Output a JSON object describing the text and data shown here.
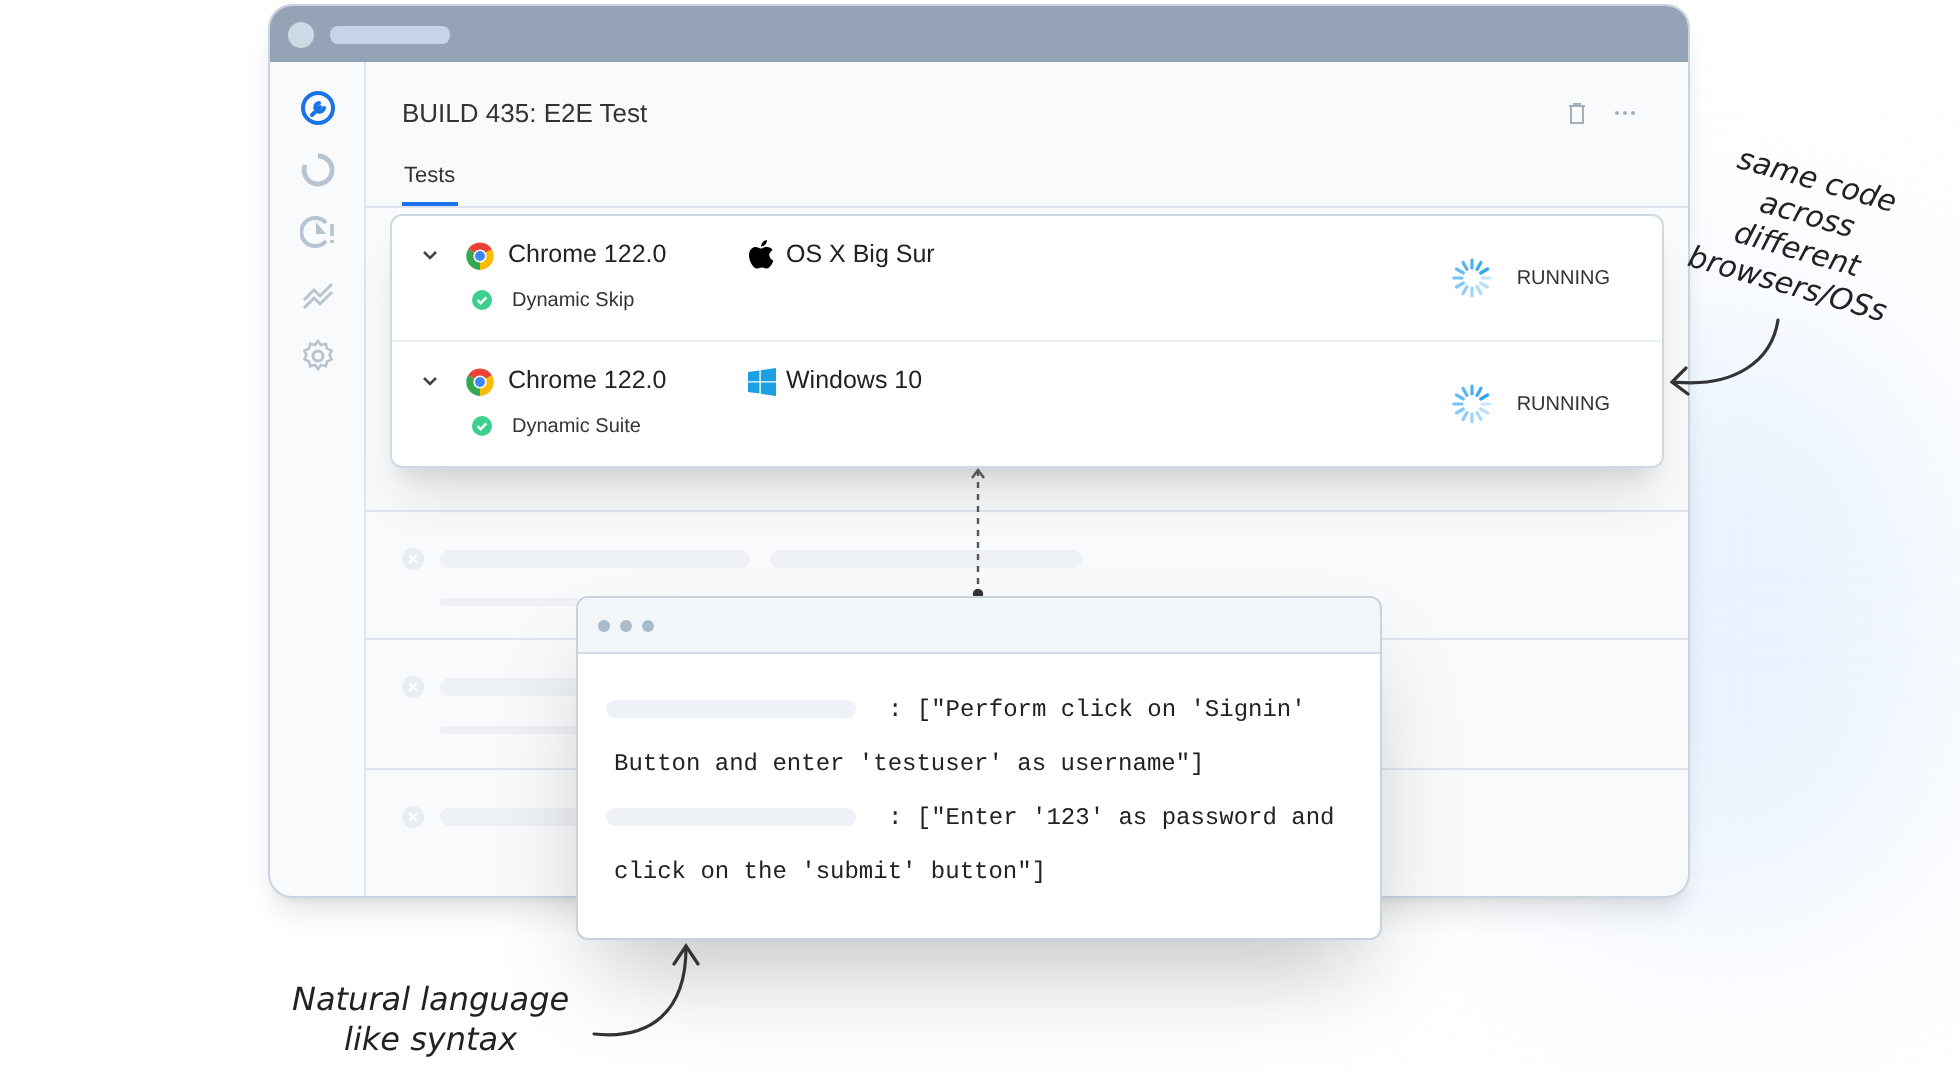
{
  "window": {
    "title": "BUILD 435: E2E Test",
    "sidebar": {
      "items": [
        {
          "kind": "wrench",
          "selected": true
        },
        {
          "kind": "ring",
          "selected": false
        },
        {
          "kind": "alert-clock",
          "selected": false
        },
        {
          "kind": "trend",
          "selected": false
        },
        {
          "kind": "gear",
          "selected": false
        }
      ]
    },
    "tabs": [
      {
        "label": "Tests",
        "selected": true
      }
    ],
    "skeleton_rows": [
      {
        "kind": "wide"
      },
      {
        "kind": "two-line"
      },
      {
        "kind": "one-line"
      }
    ]
  },
  "test_card": {
    "rows": [
      {
        "browser": "Chrome 122.0",
        "os": "OS X Big Sur",
        "kind": "apple",
        "suite": "Dynamic Skip",
        "status": "RUNNING"
      },
      {
        "browser": "Chrome 122.0",
        "os": "Windows 10",
        "kind": "windows",
        "suite": "Dynamic Suite",
        "status": "RUNNING"
      }
    ]
  },
  "code_popup": {
    "lines": [
      {
        "first_line": ": [\"Perform click on 'Signin'",
        "continuation": "Button and enter 'testuser' as username\"]"
      },
      {
        "first_line": ": [\"Enter '123' as password and",
        "continuation": "click on the 'submit' button\"]"
      }
    ]
  },
  "annotations": [
    {
      "kind": "right",
      "text": "same code\nacross\ndifferent\nbrowsers/OSs"
    },
    {
      "kind": "left",
      "text": "Natural language\nlike syntax"
    }
  ]
}
